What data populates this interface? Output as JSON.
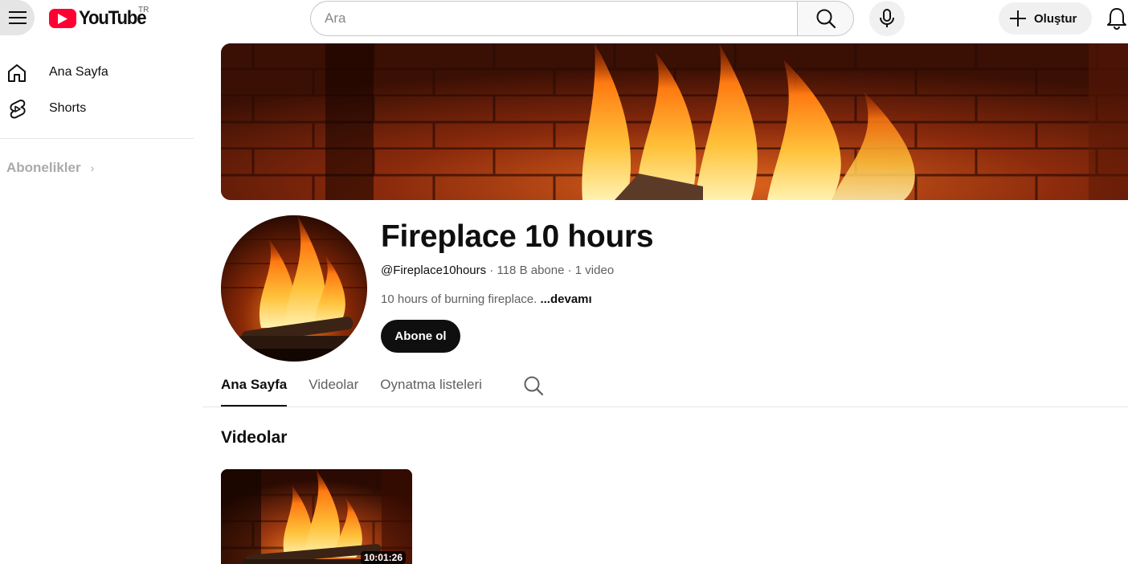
{
  "header": {
    "logo_text": "YouTube",
    "country_code": "TR",
    "search_placeholder": "Ara",
    "create_label": "Oluştur"
  },
  "sidebar": {
    "items": [
      {
        "label": "Ana Sayfa",
        "icon": "home-icon"
      },
      {
        "label": "Shorts",
        "icon": "shorts-icon"
      }
    ],
    "subscriptions_label": "Abonelikler",
    "subscriptions_chevron": "›"
  },
  "channel": {
    "name": "Fireplace 10 hours",
    "handle": "@Fireplace10hours",
    "separator": " · ",
    "subscribers": "118 B abone",
    "video_count": "1 video",
    "description": "10 hours of burning fireplace. ",
    "more_label": "...devamı",
    "subscribe_label": "Abone ol"
  },
  "tabs": [
    {
      "label": "Ana Sayfa",
      "active": true
    },
    {
      "label": "Videolar",
      "active": false
    },
    {
      "label": "Oynatma listeleri",
      "active": false
    }
  ],
  "videos_section": {
    "title": "Videolar",
    "items": [
      {
        "duration": "10:01:26"
      }
    ]
  },
  "colors": {
    "brand_red": "#ff0033",
    "text_primary": "#0f0f0f",
    "text_secondary": "#606060",
    "chip_bg": "#f0f0f0"
  }
}
